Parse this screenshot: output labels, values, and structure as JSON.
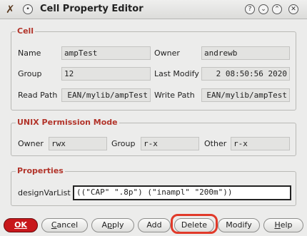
{
  "window": {
    "title": "Cell Property Editor",
    "help_glyph": "?",
    "minimize_glyph": "⌄",
    "maximize_glyph": "⌃",
    "close_glyph": "✕",
    "menu_glyph": "•"
  },
  "cell": {
    "title": "Cell",
    "name_label": "Name",
    "name_value": "ampTest",
    "owner_label": "Owner",
    "owner_value": "andrewb",
    "group_label": "Group",
    "group_value": "12",
    "last_modify_label": "Last Modify",
    "last_modify_value": "2 08:50:56 2020",
    "read_path_label": "Read Path",
    "read_path_value": "EAN/mylib/ampTest",
    "write_path_label": "Write Path",
    "write_path_value": "EAN/mylib/ampTest"
  },
  "unix": {
    "title": "UNIX Permission Mode",
    "owner_label": "Owner",
    "owner_value": "rwx",
    "group_label": "Group",
    "group_value": "r-x",
    "other_label": "Other",
    "other_value": "r-x"
  },
  "properties": {
    "title": "Properties",
    "design_var_label": "designVarList",
    "design_var_value": "((\"CAP\" \".8p\") (\"inampl\" \"200m\"))"
  },
  "buttons": {
    "ok": "OK",
    "cancel_first": "C",
    "cancel_rest": "ancel",
    "apply_first": "A",
    "apply_u": "p",
    "apply_rest": "ply",
    "add": "Add",
    "delete": "Delete",
    "modify": "Modify",
    "help_first": "H",
    "help_rest": "elp"
  },
  "colors": {
    "group_title": "#b2342a",
    "ok_button": "#c8171b",
    "highlight": "#e13a2a"
  }
}
